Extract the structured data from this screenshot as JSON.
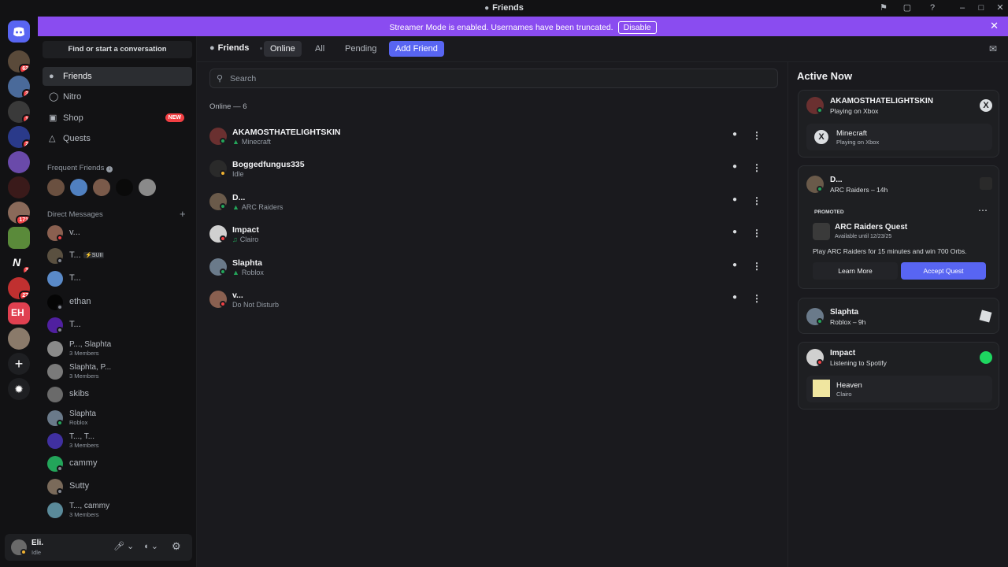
{
  "window": {
    "title": "Friends"
  },
  "colors": {
    "accent": "#5865f2",
    "banner": "#8a4cf0",
    "online": "#23a55a",
    "idle": "#f0b232",
    "dnd": "#f23f43",
    "bg": "#1a1a1e",
    "spotify": "#1ed760"
  },
  "servers": [
    {
      "name": "discord-home",
      "badge": ""
    },
    {
      "name": "server-1",
      "badge": "62"
    },
    {
      "name": "server-2",
      "badge": "3"
    },
    {
      "name": "server-3",
      "badge": "1"
    },
    {
      "name": "server-4",
      "badge": "2"
    },
    {
      "name": "server-5",
      "badge": ""
    },
    {
      "name": "server-6",
      "badge": ""
    },
    {
      "name": "server-7",
      "badge": "171"
    },
    {
      "name": "server-8",
      "badge": ""
    },
    {
      "name": "server-9",
      "badge": "3"
    },
    {
      "name": "server-10",
      "badge": "27"
    },
    {
      "name": "server-11",
      "badge": ""
    },
    {
      "name": "server-12",
      "badge": ""
    }
  ],
  "banner": {
    "message": "Streamer Mode is enabled. Usernames have been truncated.",
    "button": "Disable"
  },
  "sidebar": {
    "find_placeholder": "Find or start a conversation",
    "nav": [
      {
        "label": "Friends",
        "icon": "friends-icon"
      },
      {
        "label": "Nitro",
        "icon": "nitro-icon"
      },
      {
        "label": "Shop",
        "icon": "shop-icon",
        "badge": "NEW"
      },
      {
        "label": "Quests",
        "icon": "quests-icon"
      }
    ],
    "frequent_title": "Frequent Friends",
    "dm_title": "Direct Messages",
    "dms": [
      {
        "name": "v...",
        "sub": "",
        "status": "dnd"
      },
      {
        "name": "T...",
        "tag": "⚡SUII",
        "sub": "",
        "status": "offline"
      },
      {
        "name": "T...",
        "sub": "",
        "status": "offline"
      },
      {
        "name": "ethan",
        "sub": "",
        "status": "offline"
      },
      {
        "name": "T...",
        "sub": "",
        "status": "offline"
      },
      {
        "name": "P..., Slaphta",
        "sub": "3 Members",
        "status": "group"
      },
      {
        "name": "Slaphta, P...",
        "sub": "3 Members",
        "status": "group"
      },
      {
        "name": "skibs",
        "sub": "",
        "status": "offline"
      },
      {
        "name": "Slaphta",
        "sub": "Roblox",
        "status": "online"
      },
      {
        "name": "T..., T...",
        "sub": "3 Members",
        "status": "group"
      },
      {
        "name": "cammy",
        "sub": "",
        "status": "offline"
      },
      {
        "name": "Sutty",
        "sub": "",
        "status": "offline"
      },
      {
        "name": "T..., cammy",
        "sub": "3 Members",
        "status": "group"
      }
    ],
    "user": {
      "name": "Eli.",
      "status": "Idle"
    }
  },
  "topbar": {
    "title": "Friends",
    "tabs": [
      "Online",
      "All",
      "Pending"
    ],
    "add_friend": "Add Friend"
  },
  "search": {
    "placeholder": "Search"
  },
  "online": {
    "header": "Online — 6",
    "friends": [
      {
        "name": "AKAMOSTHATELIGHTSKIN",
        "status_text": "Minecraft",
        "status": "online",
        "activity_icon": "game-controller-icon"
      },
      {
        "name": "Boggedfungus335",
        "status_text": "Idle",
        "status": "idle",
        "activity_icon": ""
      },
      {
        "name": "D...",
        "status_text": "ARC Raiders",
        "status": "online",
        "activity_icon": "game-controller-icon"
      },
      {
        "name": "Impact",
        "status_text": "Clairo",
        "status": "dnd",
        "activity_icon": "music-note-icon"
      },
      {
        "name": "Slaphta",
        "status_text": "Roblox",
        "status": "online",
        "activity_icon": "game-controller-icon"
      },
      {
        "name": "v...",
        "status_text": "Do Not Disturb",
        "status": "dnd",
        "activity_icon": ""
      }
    ]
  },
  "active_now": {
    "title": "Active Now",
    "cards": [
      {
        "name": "AKAMOSTHATELIGHTSKIN",
        "sub": "Playing on Xbox",
        "icon": "xbox-icon",
        "inner": {
          "title": "Minecraft",
          "sub": "Playing on Xbox"
        }
      },
      {
        "name": "D...",
        "sub": "ARC Raiders – 14h",
        "promoted": "PROMOTED",
        "quest_title": "ARC Raiders Quest",
        "quest_sub": "Available until 12/23/25",
        "quest_desc": "Play ARC Raiders for 15 minutes and win 700 Orbs.",
        "learn_more": "Learn More",
        "accept": "Accept Quest"
      },
      {
        "name": "Slaphta",
        "sub": "Roblox – 9h",
        "icon": "roblox-icon"
      },
      {
        "name": "Impact",
        "sub": "Listening to Spotify",
        "icon": "spotify-icon",
        "inner": {
          "title": "Heaven",
          "sub": "Clairo"
        }
      }
    ]
  }
}
